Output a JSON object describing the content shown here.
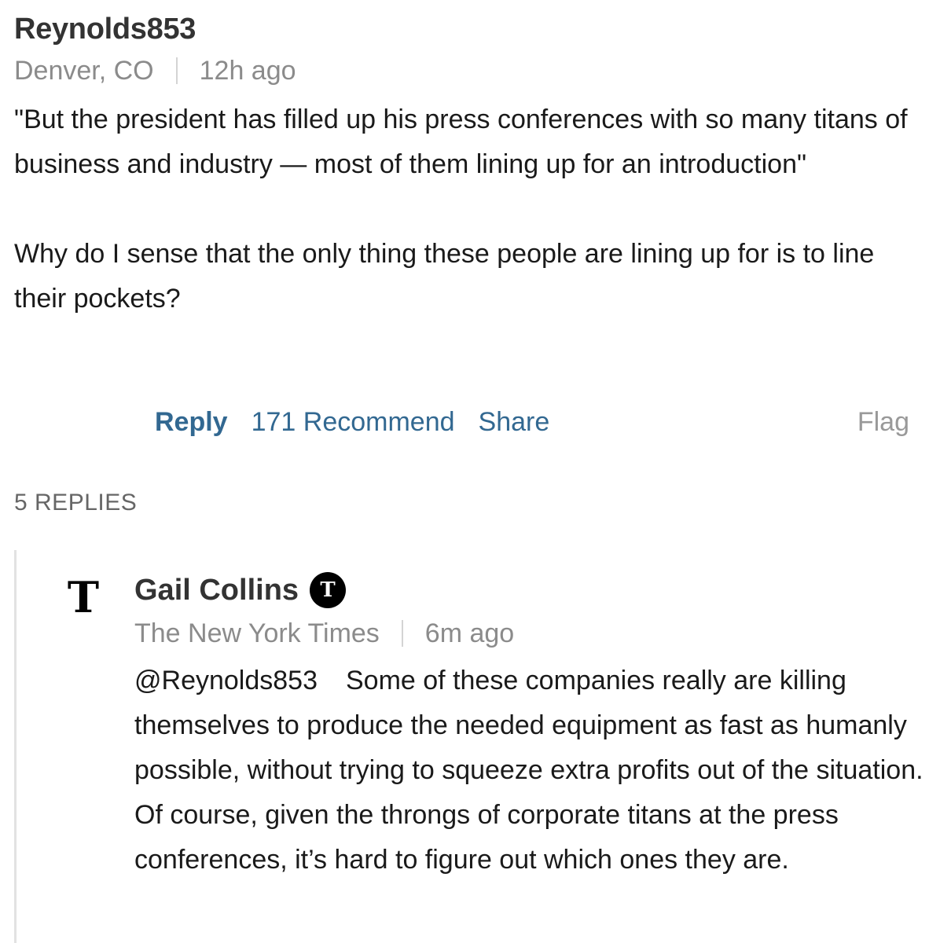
{
  "comment": {
    "username": "Reynolds853",
    "location": "Denver, CO",
    "time": "12h ago",
    "paragraphs": [
      "\"But the president has filled up his press conferences with so many titans of business and industry — most of them lining up for an introduction\"",
      "Why do I sense that the only thing these people are lining up for is to line their pockets?"
    ],
    "actions": {
      "reply": "Reply",
      "recommend": "171 Recommend",
      "share": "Share",
      "flag": "Flag"
    },
    "replies_count": "5 REPLIES"
  },
  "reply": {
    "logo_icon": "nyt-logo-icon",
    "logo_glyph": "T",
    "author": "Gail Collins",
    "badge_icon": "nyt-verified-icon",
    "badge_glyph": "T",
    "affiliation": "The New York Times",
    "time": "6m ago",
    "mention": "@Reynolds853",
    "text": "Some of these companies really are killing themselves to produce the needed equipment as fast as humanly possible, without trying to squeeze extra profits out of the situation. Of course, given the  throngs of corporate titans at the press conferences, it’s hard to figure out which ones they are."
  },
  "colors": {
    "link": "#326891",
    "muted": "#8b8b8b",
    "thread_border": "#e2e2e2"
  }
}
